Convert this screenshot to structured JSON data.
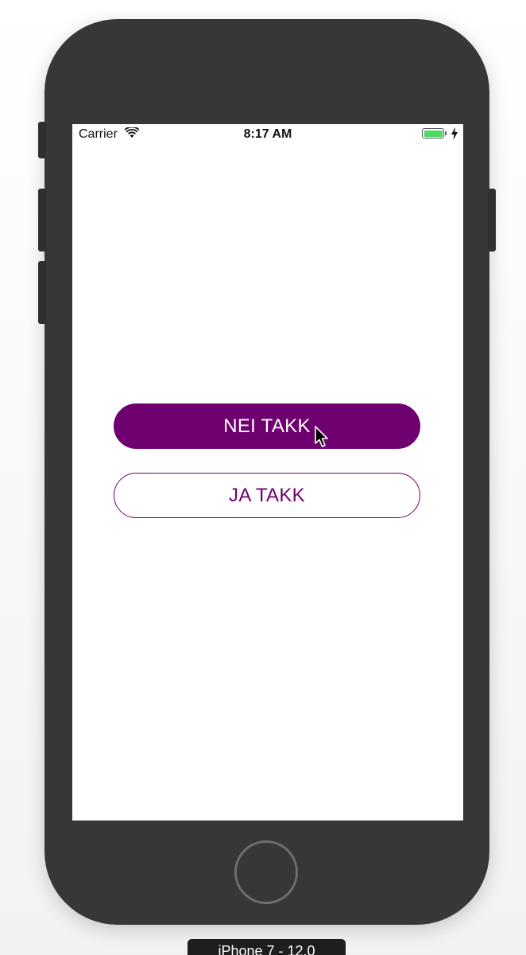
{
  "status_bar": {
    "carrier": "Carrier",
    "time": "8:17 AM",
    "battery_color": "#4cd964"
  },
  "buttons": {
    "primary_label": "NEI TAKK",
    "secondary_label": "JA TAKK",
    "accent_color": "#6f006f"
  },
  "simulator": {
    "device_label": "iPhone 7 - 12.0"
  },
  "icons": [
    "wifi-icon",
    "battery-icon",
    "charging-bolt-icon",
    "mouse-cursor-icon"
  ]
}
